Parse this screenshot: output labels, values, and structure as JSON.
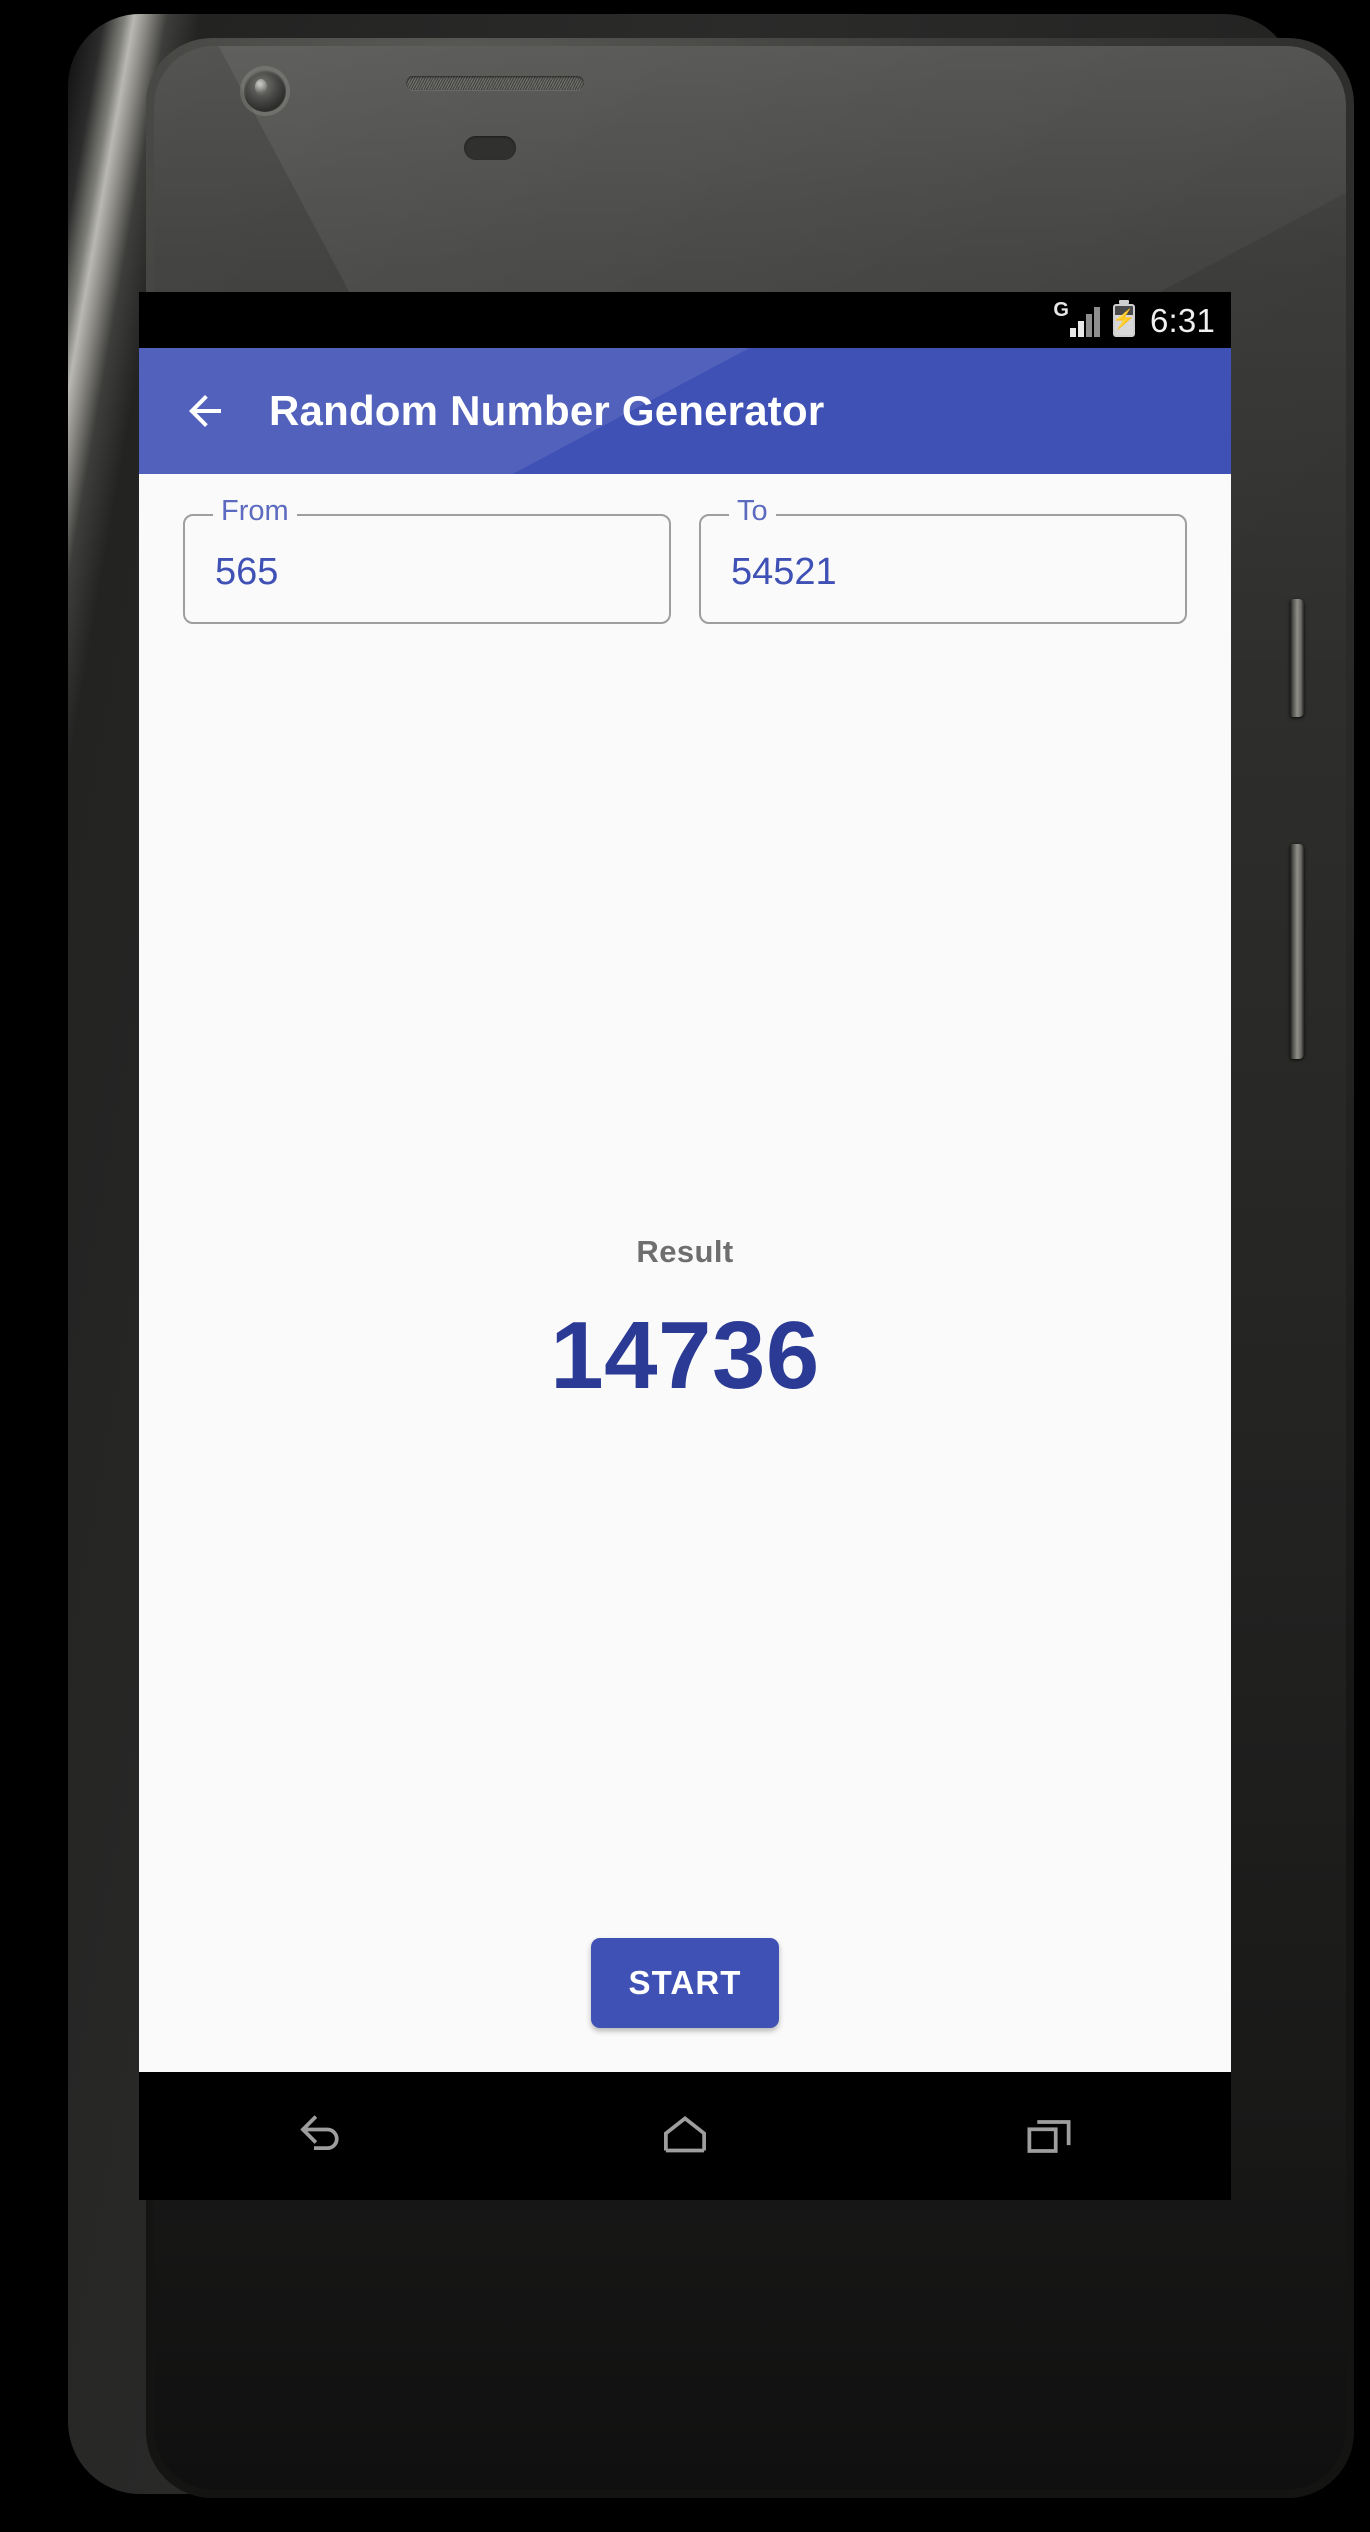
{
  "device": {
    "name": "android-phone",
    "camera_icon": "front-camera-icon",
    "speaker_icon": "earpiece-speaker-icon",
    "sensor_icon": "proximity-sensor-icon",
    "power_button": "power-button",
    "volume_button": "volume-rocker-button"
  },
  "status_bar": {
    "network_type": "G",
    "signal_icon": "signal-bars-icon",
    "signal_bars_filled": 2,
    "signal_bars_total": 4,
    "battery_icon": "battery-charging-icon",
    "battery_bolt": "⚡",
    "time": "6:31"
  },
  "app_bar": {
    "back_icon": "back-arrow-icon",
    "title": "Random Number Generator",
    "background_color": "#3f51b5",
    "title_color": "#ffffff"
  },
  "form": {
    "from_field": {
      "label": "From",
      "value": "565",
      "placeholder": "From"
    },
    "to_field": {
      "label": "To",
      "value": "54521",
      "placeholder": "To"
    },
    "border_color": "#9e9e9e",
    "label_color": "#5c6bc0",
    "value_color": "#3f51b5"
  },
  "result": {
    "label": "Result",
    "value": "14736",
    "label_color": "#6e6e6e",
    "value_color": "#2b3a94"
  },
  "actions": {
    "start_label": "START",
    "start_color": "#3f51b5"
  },
  "nav_bar": {
    "back_icon": "nav-back-icon",
    "home_icon": "nav-home-icon",
    "recents_icon": "nav-recents-icon",
    "icon_color": "#9e9e9e"
  }
}
